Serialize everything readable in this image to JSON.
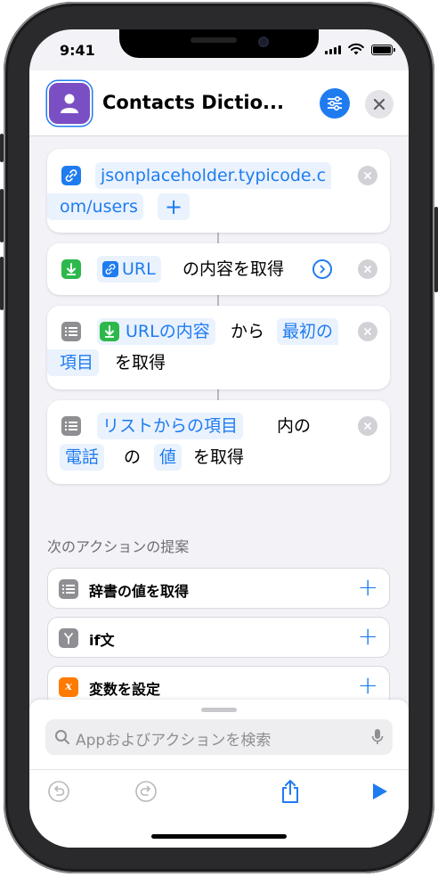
{
  "status": {
    "time": "9:41"
  },
  "header": {
    "title": "Contacts Dictio..."
  },
  "actions": [
    {
      "url_part1": "jsonplaceholder.typicode.c",
      "url_part2": "om/users",
      "add": "+"
    },
    {
      "var": "URL",
      "text": "の内容を取得"
    },
    {
      "var": "URLの内容",
      "from": "から",
      "pick1": "最初の",
      "pick2": "項目",
      "get": "を取得"
    },
    {
      "var": "リストからの項目",
      "in": "内の",
      "key": "電話",
      "no": "の",
      "val": "値",
      "get": "を取得"
    }
  ],
  "suggestions": {
    "title": "次のアクションの提案",
    "items": [
      {
        "label": "辞書の値を取得",
        "icon": "list-icon",
        "color": "#8e8e93"
      },
      {
        "label": "if文",
        "icon": "branch-icon",
        "color": "#8e8e93"
      },
      {
        "label": "変数を設定",
        "icon": "variable-icon",
        "color": "#ff7a00"
      }
    ],
    "plus": "+"
  },
  "search": {
    "placeholder": "Appおよびアクションを検索"
  },
  "colors": {
    "accent": "#1f7cf0",
    "app_icon": "#7b4fc4"
  }
}
